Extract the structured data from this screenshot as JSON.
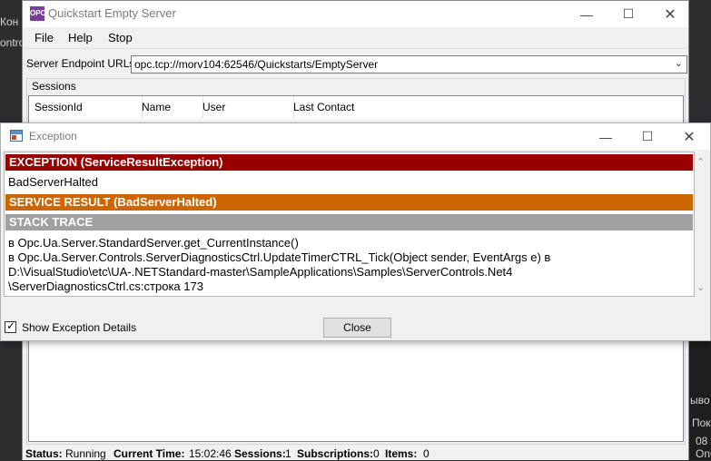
{
  "background": {
    "left_fragments": [
      "Кон",
      "ontro"
    ],
    "right_fragments": [
      "ыво",
      "Пок",
      "08",
      "OnC"
    ]
  },
  "main_window": {
    "title": "Quickstart Empty Server",
    "menu": [
      "File",
      "Help",
      "Stop"
    ],
    "endpoint_label": "Server Endpoint URLs",
    "endpoint_value": "opc.tcp://morv104:62546/Quickstarts/EmptyServer",
    "sessions_group_label": "Sessions",
    "columns": [
      "SessionId",
      "Name",
      "User",
      "Last Contact"
    ],
    "status": {
      "status_label": "Status:",
      "status_value": "Running",
      "time_label": "Current Time:",
      "time_value": "15:02:46",
      "sessions_label": "Sessions:",
      "sessions_value": "1",
      "subscriptions_label": "Subscriptions:",
      "subscriptions_value": "0",
      "items_label": "Items:",
      "items_value": "0"
    }
  },
  "dialog": {
    "title": "Exception",
    "exception_header": "EXCEPTION (ServiceResultException)",
    "exception_message": "BadServerHalted",
    "service_result_header": "SERVICE RESULT (BadServerHalted)",
    "stack_trace_header": "STACK TRACE",
    "stack_trace_lines": [
      "в Opc.Ua.Server.StandardServer.get_CurrentInstance()",
      "в Opc.Ua.Server.Controls.ServerDiagnosticsCtrl.UpdateTimerCTRL_Tick(Object sender, EventArgs e) в",
      "D:\\VisualStudio\\etc\\UA-.NETStandard-master\\SampleApplications\\Samples\\ServerControls.Net4",
      "\\ServerDiagnosticsCtrl.cs:строка 173"
    ],
    "show_details_label": "Show Exception Details",
    "show_details_checked": true,
    "close_label": "Close"
  },
  "colors": {
    "exception_band": "#990000",
    "service_result_band": "#cc6600",
    "stack_trace_band": "#a0a0a0"
  }
}
